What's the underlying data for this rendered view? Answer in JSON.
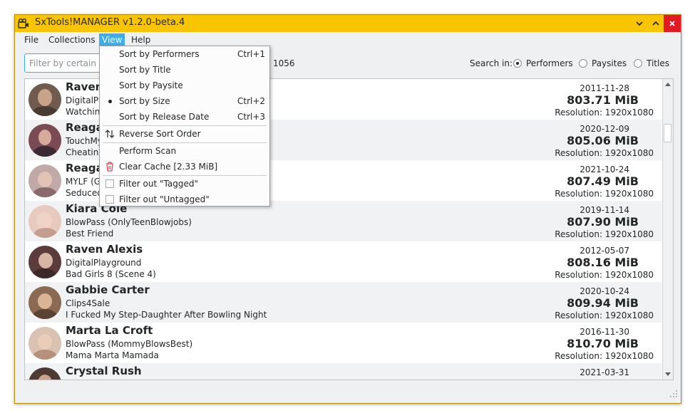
{
  "window": {
    "title": "SxTools!MANAGER v1.2.0-beta.4"
  },
  "icons": {
    "app": "app-icon",
    "minimize": "chevron-down-icon",
    "maximize": "chevron-up-icon",
    "close": "close-icon",
    "reverse": "sort-arrows-icon",
    "clear_cache": "trash-icon"
  },
  "colors": {
    "titlebar": "#f9c400",
    "accent": "#3daee9",
    "close": "#e01b24"
  },
  "menu": [
    {
      "label": "File"
    },
    {
      "label": "Collections"
    },
    {
      "label": "View"
    },
    {
      "label": "Help"
    }
  ],
  "filter": {
    "placeholder": "Filter by certain Va"
  },
  "count": "1056",
  "search": {
    "label": "Search in:",
    "options": [
      {
        "label": "Performers",
        "selected": true
      },
      {
        "label": "Paysites",
        "selected": false
      },
      {
        "label": "Titles",
        "selected": false
      }
    ]
  },
  "view_menu": {
    "items": [
      {
        "label": "Sort by Performers",
        "shortcut": "Ctrl+1"
      },
      {
        "label": "Sort by Title",
        "shortcut": ""
      },
      {
        "label": "Sort by Paysite",
        "shortcut": ""
      },
      {
        "label": "Sort by Size",
        "shortcut": "Ctrl+2",
        "checked": true
      },
      {
        "label": "Sort by Release Date",
        "shortcut": "Ctrl+3"
      },
      {
        "label": "Reverse Sort Order"
      },
      {
        "label": "Perform Scan"
      },
      {
        "label": "Clear Cache [2.33 MiB]"
      },
      {
        "label": "Filter out \"Tagged\"",
        "checked": false
      },
      {
        "label": "Filter out \"Untagged\"",
        "checked": false
      }
    ]
  },
  "items": [
    {
      "performer": "Raven",
      "paysite": "DigitalPla",
      "title": "Watching",
      "date": "2011-11-28",
      "size": "803.71 MiB",
      "resolution": "Resolution: 1920x1080"
    },
    {
      "performer": "Reaga",
      "paysite": "TouchMy",
      "title": "Cheating",
      "date": "2020-12-09",
      "size": "805.06 MiB",
      "resolution": "Resolution: 1920x1080"
    },
    {
      "performer": "Reaga",
      "paysite": "MYLF (G",
      "title": "Seduced",
      "date": "2021-10-24",
      "size": "807.49 MiB",
      "resolution": "Resolution: 1920x1080"
    },
    {
      "performer": "Kiara Cole",
      "paysite": "BlowPass (OnlyTeenBlowjobs)",
      "title": "Best Friend",
      "date": "2019-11-14",
      "size": "807.90 MiB",
      "resolution": "Resolution: 1920x1080"
    },
    {
      "performer": "Raven Alexis",
      "paysite": "DigitalPlayground",
      "title": "Bad Girls 8 (Scene 4)",
      "date": "2012-05-07",
      "size": "808.16 MiB",
      "resolution": "Resolution: 1920x1080"
    },
    {
      "performer": "Gabbie Carter",
      "paysite": "Clips4Sale",
      "title": "I Fucked My Step-Daughter After Bowling Night",
      "date": "2020-10-24",
      "size": "809.94 MiB",
      "resolution": "Resolution: 1920x1080"
    },
    {
      "performer": "Marta La Croft",
      "paysite": "BlowPass (MommyBlowsBest)",
      "title": "Mama Marta Mamada",
      "date": "2016-11-30",
      "size": "810.70 MiB",
      "resolution": "Resolution: 1920x1080"
    },
    {
      "performer": "Crystal Rush",
      "paysite": "",
      "title": "",
      "date": "2021-03-31",
      "size": "",
      "resolution": ""
    }
  ]
}
